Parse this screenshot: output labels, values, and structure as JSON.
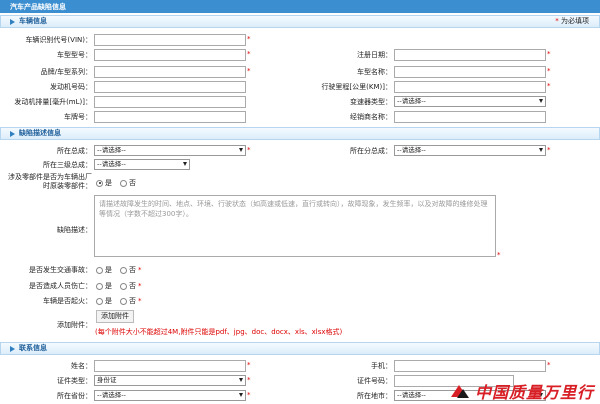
{
  "page": {
    "title": "汽车产品缺陷信息"
  },
  "sections": {
    "vehicle": {
      "title": "车辆信息",
      "required_note_star": "*",
      "required_note": "为必填项"
    },
    "defect": {
      "title": "缺陷描述信息"
    },
    "contact": {
      "title": "联系信息"
    }
  },
  "vehicle": {
    "vin_label": "车辆识别代号(VIN)：",
    "model_no_label": "车型型号：",
    "reg_date_label": "注册日期：",
    "brand_label": "品牌/车型系列：",
    "model_name_label": "车型名称：",
    "engine_no_label": "发动机号码：",
    "mileage_label": "行驶里程[公里(KM)]：",
    "displacement_label": "发动机排量[毫升(mL)]：",
    "transmission_label": "变速器类型：",
    "transmission_value": "--请选择--",
    "plate_label": "车牌号：",
    "dealer_label": "经销商名称："
  },
  "defect": {
    "assembly_label": "所在总成：",
    "assembly_value": "--请选择--",
    "sub_assembly_label": "所在分总成：",
    "sub_assembly_value": "--请选择--",
    "level3_label": "所在三级总成：",
    "level3_value": "--请选择--",
    "original_part_label": "涉及零部件是否为车辆出厂时原装零部件：",
    "yes": "是",
    "no": "否",
    "desc_label": "缺陷描述：",
    "desc_placeholder": "请描述故障发生的时间、地点、环境、行驶状态（如高速或低速，直行或转向），故障现象，发生频率，以及对故障的维修处理等情况（字数不超过300字）。",
    "accident_label": "是否发生交通事故：",
    "injury_label": "是否造成人员伤亡：",
    "fire_label": "车辆是否起火：",
    "attach_label": "添加附件：",
    "attach_button": "添加附件",
    "attach_hint": "(每个附件大小不能超过4M,附件只能是pdf、jpg、doc、docx、xls、xlsx格式)"
  },
  "contact": {
    "name_label": "姓名：",
    "phone_label": "手机：",
    "id_type_label": "证件类型：",
    "id_type_value": "身份证",
    "id_no_label": "证件号码：",
    "province_label": "所在省份：",
    "province_value": "--请选择--",
    "city_label": "所在地市：",
    "city_value": "--请选择--"
  },
  "watermark": {
    "text": "中国质量万里行"
  },
  "colors": {
    "title_bar": "#3b8fd1",
    "required": "#dd0000",
    "section_text": "#1f5f9a"
  }
}
